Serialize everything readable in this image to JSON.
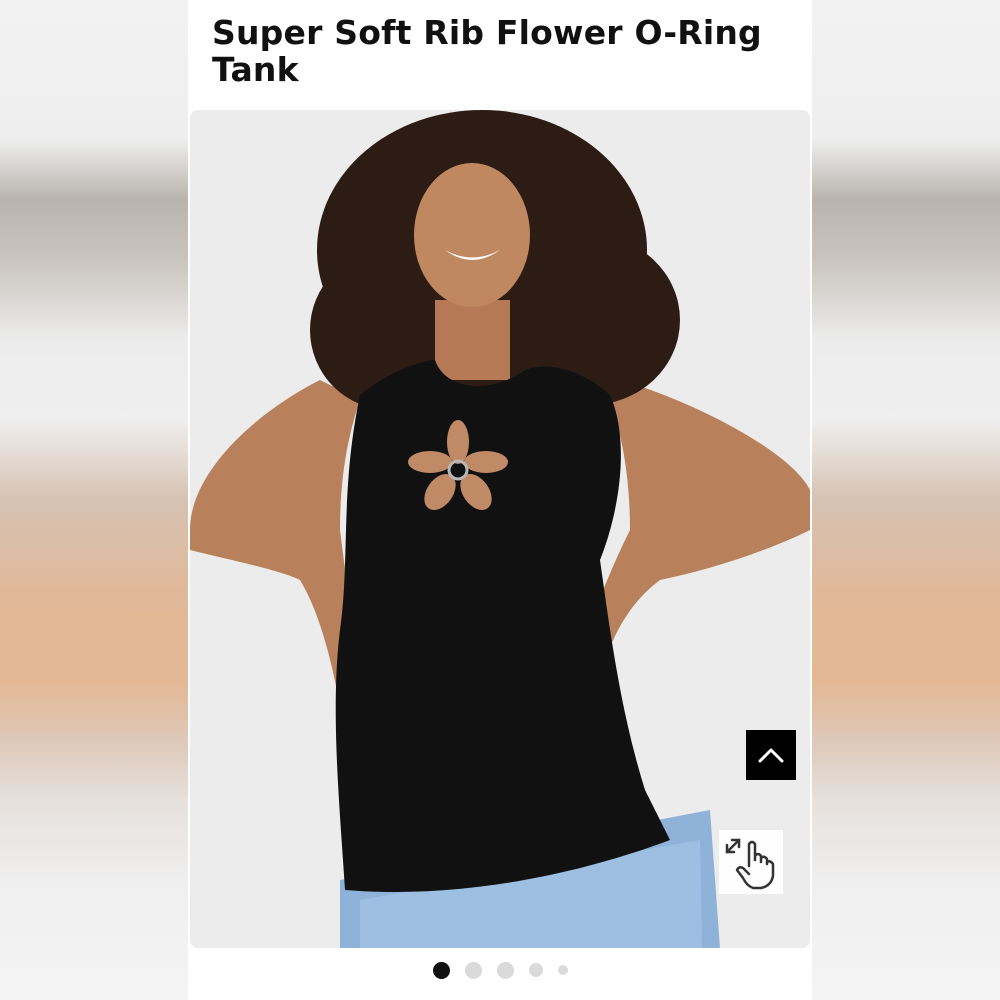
{
  "product": {
    "title": "Super Soft Rib Flower O-Ring Tank"
  },
  "gallery": {
    "image_description_icon": "product-photo",
    "slide_count": 5,
    "active_slide": 1
  },
  "controls": {
    "back_to_top_icon": "chevron-up-icon",
    "zoom_icon": "pinch-zoom-hand-icon"
  },
  "colors": {
    "title": "#111111",
    "button_dark": "#000000",
    "dot_active": "#111111",
    "dot_inactive": "#dadada"
  }
}
